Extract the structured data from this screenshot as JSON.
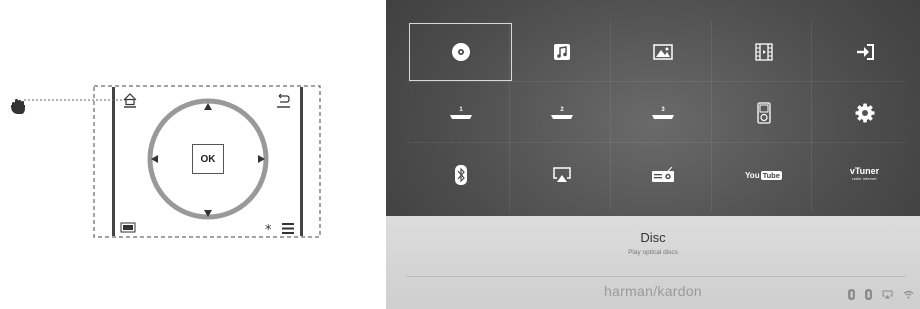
{
  "remote": {
    "ok_label": "OK"
  },
  "grid": {
    "selected_index": 0,
    "tiles": [
      {
        "icon": "disc-icon"
      },
      {
        "icon": "music-icon"
      },
      {
        "icon": "photo-icon"
      },
      {
        "icon": "film-icon"
      },
      {
        "icon": "input-icon"
      },
      {
        "icon": "hdmi-1-icon",
        "num": "1"
      },
      {
        "icon": "hdmi-2-icon",
        "num": "2"
      },
      {
        "icon": "hdmi-3-icon",
        "num": "3"
      },
      {
        "icon": "ipod-icon"
      },
      {
        "icon": "gear-icon"
      },
      {
        "icon": "bluetooth-icon"
      },
      {
        "icon": "airplay-icon"
      },
      {
        "icon": "radio-icon"
      },
      {
        "icon": "youtube-logo",
        "text_a": "You",
        "text_b": "Tube"
      },
      {
        "icon": "vtuner-logo",
        "text_a": "vTuner",
        "text_b": "radio internet"
      }
    ]
  },
  "info": {
    "title": "Disc",
    "subtitle": "Play optical discs",
    "brand": "harman/kardon"
  },
  "status_icons": [
    "bluetooth-icon",
    "bluetooth-icon",
    "airplay-icon",
    "wifi-icon"
  ],
  "colors": {
    "screen_bg": "#4d4d4d",
    "info_bg": "#d6d6d6",
    "selection": "#d8d8d8"
  }
}
